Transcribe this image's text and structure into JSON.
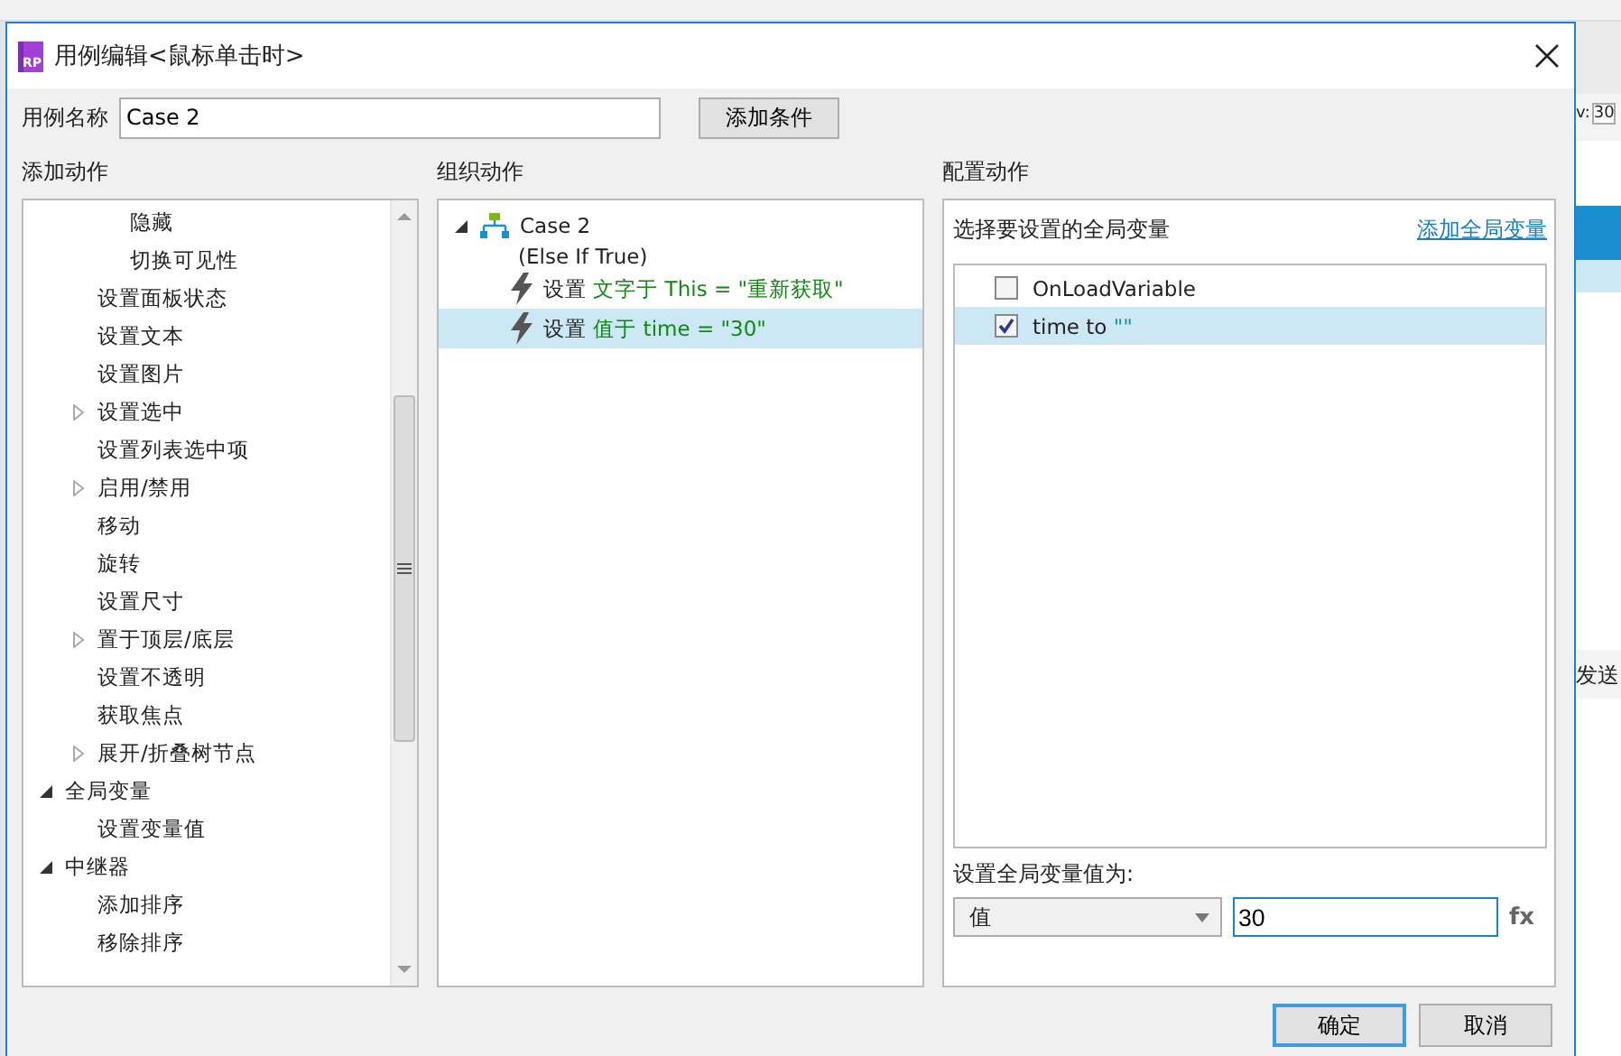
{
  "window": {
    "badge": "RP",
    "title": "用例编辑<鼠标单击时>"
  },
  "case_name": {
    "label": "用例名称",
    "value": "Case 2"
  },
  "add_condition_button": "添加条件",
  "add_actions": {
    "title": "添加动作",
    "items": [
      {
        "children": [
          {
            "children": [
              {
                "label": "隐藏"
              },
              {
                "label": "切换可见性"
              }
            ]
          },
          {
            "label": "设置面板状态"
          },
          {
            "label": "设置文本"
          },
          {
            "label": "设置图片"
          },
          {
            "label": "设置选中",
            "expanded": false
          },
          {
            "label": "设置列表选中项"
          },
          {
            "label": "启用/禁用",
            "expanded": false
          },
          {
            "label": "移动"
          },
          {
            "label": "旋转"
          },
          {
            "label": "设置尺寸"
          },
          {
            "label": "置于顶层/底层",
            "expanded": false
          },
          {
            "label": "设置不透明"
          },
          {
            "label": "获取焦点"
          },
          {
            "label": "展开/折叠树节点",
            "expanded": false
          }
        ]
      },
      {
        "label": "全局变量",
        "expanded": true,
        "children": [
          {
            "label": "设置变量值"
          }
        ]
      },
      {
        "label": "中继器",
        "expanded": true,
        "children": [
          {
            "label": "添加排序"
          },
          {
            "label": "移除排序"
          }
        ]
      }
    ]
  },
  "organize_actions": {
    "title": "组织动作",
    "case": {
      "name": "Case 2",
      "condition": "(Else If True)",
      "expanded": true,
      "actions": [
        {
          "verb": "设置",
          "detail": "文字于 This = \"重新获取\"",
          "selected": false
        },
        {
          "verb": "设置",
          "detail": "值于 time = \"30\"",
          "selected": true
        }
      ]
    }
  },
  "configure_action": {
    "title": "配置动作",
    "variables_label": "选择要设置的全局变量",
    "add_variable_link": "添加全局变量",
    "variables": [
      {
        "name": "OnLoadVariable",
        "checked": false,
        "selected": false
      },
      {
        "name": "time to",
        "value": "\"\"",
        "checked": true,
        "selected": true
      }
    ],
    "value_label": "设置全局变量值为:",
    "value_type": "值",
    "value": "30",
    "fx": "fx"
  },
  "buttons": [
    {
      "label": "确定",
      "default": true
    },
    {
      "label": "取消",
      "default": false
    }
  ],
  "background_app": {
    "field_label": "v:",
    "field_value": "30",
    "section_label": "发送"
  }
}
